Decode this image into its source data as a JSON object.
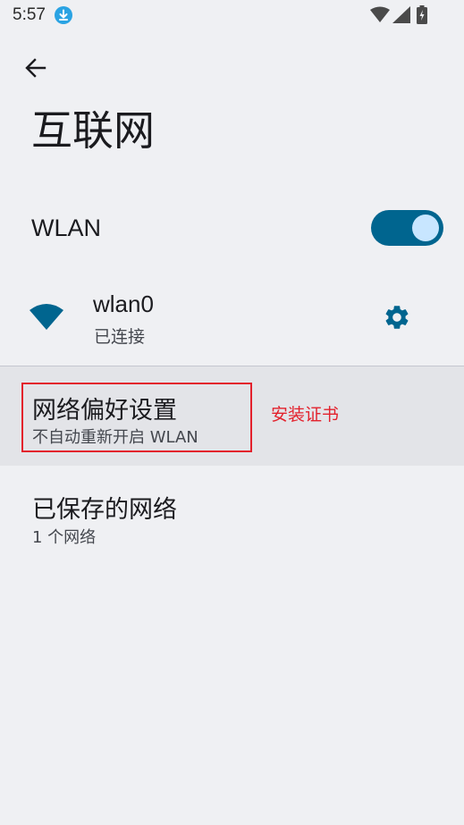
{
  "status_bar": {
    "time": "5:57",
    "icons": [
      "download-icon",
      "wifi-icon",
      "signal-icon",
      "battery-charging-icon"
    ]
  },
  "header": {
    "back_icon": "arrow-left-icon",
    "title": "互联网"
  },
  "wlan": {
    "label": "WLAN",
    "enabled": true
  },
  "network": {
    "icon": "wifi-icon",
    "name": "wlan0",
    "status": "已连接",
    "settings_icon": "gear-icon"
  },
  "preferences": {
    "title": "网络偏好设置",
    "summary": "不自动重新开启 WLAN",
    "annotation": "安装证书"
  },
  "saved_networks": {
    "title": "已保存的网络",
    "summary": "1 个网络"
  },
  "colors": {
    "accent": "#00658f",
    "toggle_knob": "#c8e6ff",
    "background": "#eff0f3",
    "highlight": "#e3212c"
  }
}
